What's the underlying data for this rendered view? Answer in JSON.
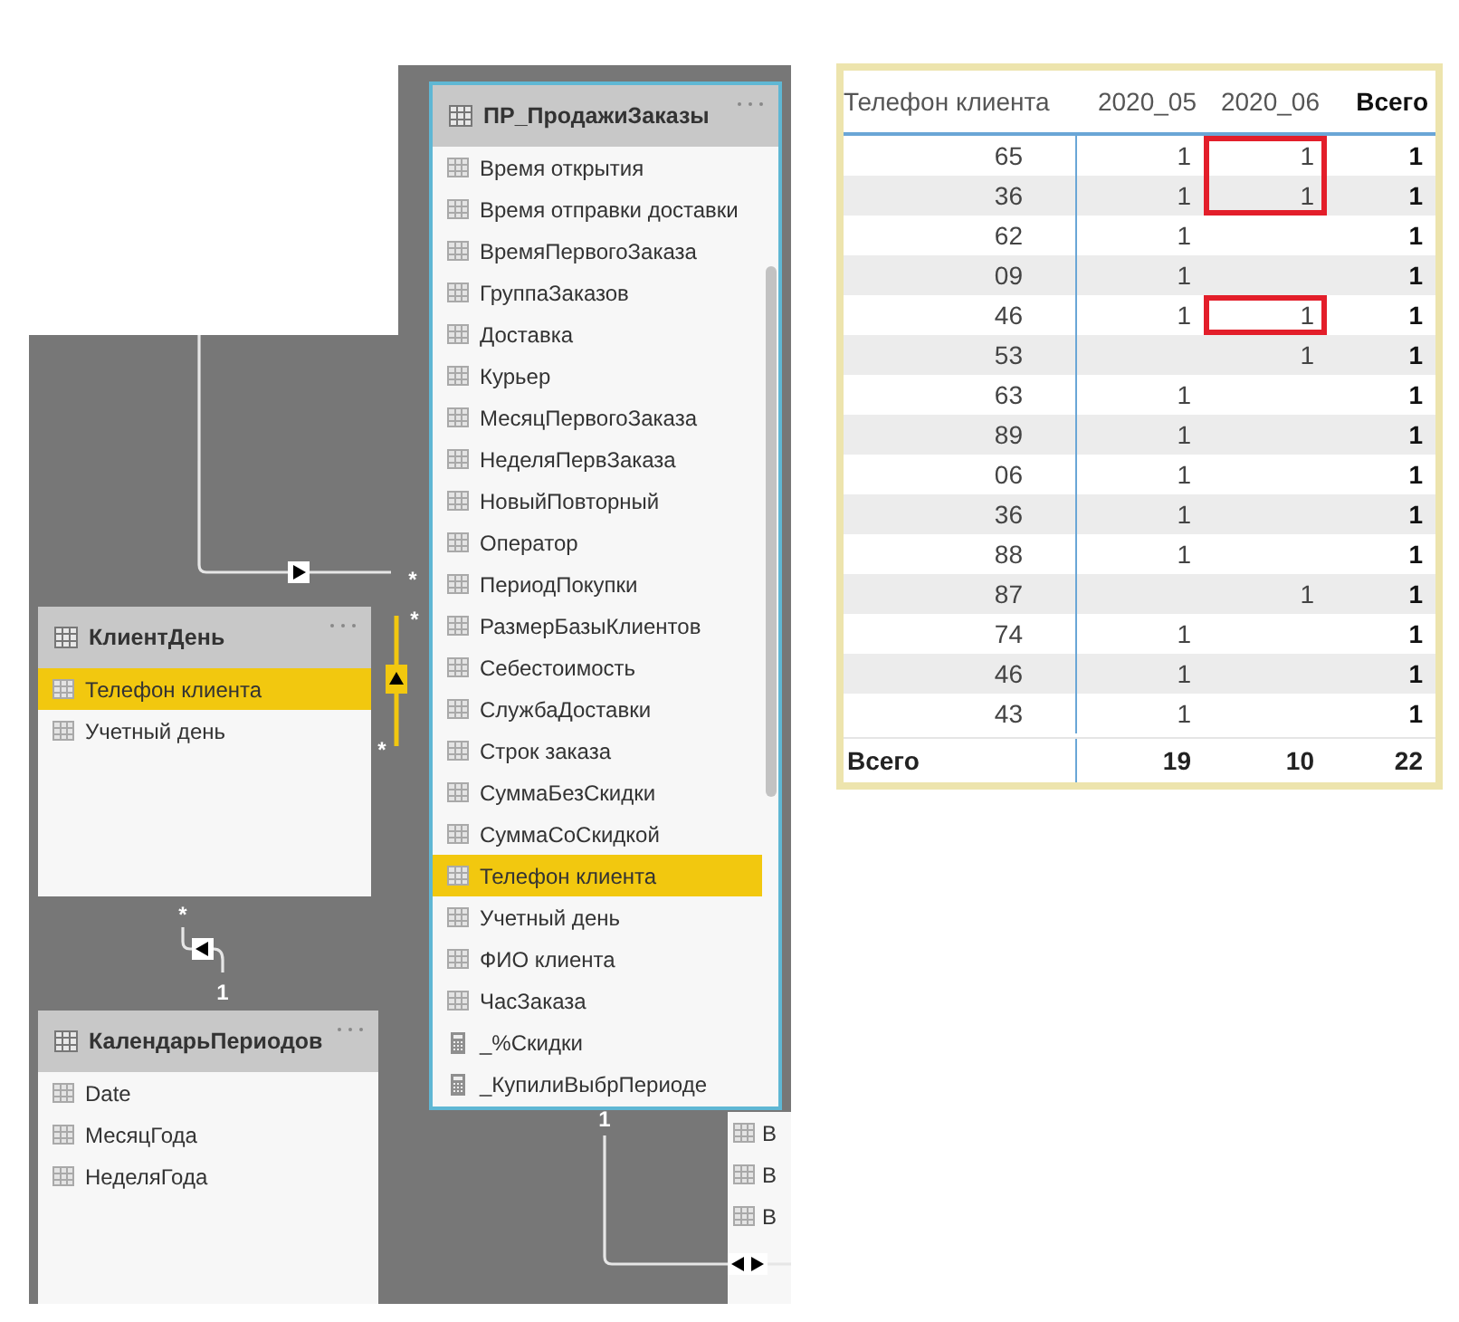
{
  "diagram": {
    "tables": [
      {
        "name": "ПР_ПродажиЗаказы",
        "selected": true,
        "fields": [
          {
            "name": "Время открытия",
            "kind": "column",
            "selected": false
          },
          {
            "name": "Время отправки доставки",
            "kind": "column",
            "selected": false
          },
          {
            "name": "ВремяПервогоЗаказа",
            "kind": "column",
            "selected": false
          },
          {
            "name": "ГруппаЗаказов",
            "kind": "column",
            "selected": false
          },
          {
            "name": "Доставка",
            "kind": "column",
            "selected": false
          },
          {
            "name": "Курьер",
            "kind": "column",
            "selected": false
          },
          {
            "name": "МесяцПервогоЗаказа",
            "kind": "column",
            "selected": false
          },
          {
            "name": "НеделяПервЗаказа",
            "kind": "column",
            "selected": false
          },
          {
            "name": "НовыйПовторный",
            "kind": "column",
            "selected": false
          },
          {
            "name": "Оператор",
            "kind": "column",
            "selected": false
          },
          {
            "name": "ПериодПокупки",
            "kind": "column",
            "selected": false
          },
          {
            "name": "РазмерБазыКлиентов",
            "kind": "column",
            "selected": false
          },
          {
            "name": "Себестоимость",
            "kind": "column",
            "selected": false
          },
          {
            "name": "СлужбаДоставки",
            "kind": "column",
            "selected": false
          },
          {
            "name": "Строк заказа",
            "kind": "column",
            "selected": false
          },
          {
            "name": "СуммаБезСкидки",
            "kind": "column",
            "selected": false
          },
          {
            "name": "СуммаСоСкидкой",
            "kind": "column",
            "selected": false
          },
          {
            "name": "Телефон клиента",
            "kind": "column",
            "selected": true
          },
          {
            "name": "Учетный день",
            "kind": "column",
            "selected": false
          },
          {
            "name": "ФИО клиента",
            "kind": "column",
            "selected": false
          },
          {
            "name": "ЧасЗаказа",
            "kind": "column",
            "selected": false
          },
          {
            "name": "_%Скидки",
            "kind": "measure",
            "selected": false
          },
          {
            "name": "_КупилиВыбрПериоде",
            "kind": "measure",
            "selected": false
          }
        ]
      },
      {
        "name": "КлиентДень",
        "selected": false,
        "fields": [
          {
            "name": "Телефон клиента",
            "kind": "column",
            "selected": true
          },
          {
            "name": "Учетный день",
            "kind": "column",
            "selected": false
          }
        ]
      },
      {
        "name": "КалендарьПериодов",
        "selected": false,
        "fields": [
          {
            "name": "Date",
            "kind": "column",
            "selected": false
          },
          {
            "name": "МесяцГода",
            "kind": "column",
            "selected": false
          },
          {
            "name": "НеделяГода",
            "kind": "column",
            "selected": false
          }
        ]
      },
      {
        "selected": false,
        "fields": [
          {
            "name": "В",
            "kind": "column",
            "selected": false
          },
          {
            "name": "В",
            "kind": "column",
            "selected": false
          },
          {
            "name": "В",
            "kind": "column",
            "selected": false
          }
        ]
      }
    ],
    "relationships": [
      {
        "kind": "right",
        "selected": false,
        "labels": [
          "*"
        ]
      },
      {
        "kind": "up",
        "selected": true,
        "labels": [
          "*",
          "*"
        ]
      },
      {
        "kind": "left",
        "selected": false,
        "labels": [
          "*",
          "1"
        ]
      },
      {
        "kind": "both",
        "selected": false,
        "labels": [
          "1"
        ]
      }
    ]
  },
  "matrix": {
    "columns": [
      "Телефон клиента",
      "2020_05",
      "2020_06",
      "Всего"
    ],
    "rows": [
      {
        "cells": [
          {
            "text": "65",
            "boxed": false
          },
          {
            "text": "1",
            "boxed": false
          },
          {
            "text": "1",
            "boxed": true
          },
          {
            "text": "1",
            "boxed": false
          }
        ]
      },
      {
        "cells": [
          {
            "text": "36",
            "boxed": false
          },
          {
            "text": "1",
            "boxed": false
          },
          {
            "text": "1",
            "boxed": true
          },
          {
            "text": "1",
            "boxed": false
          }
        ]
      },
      {
        "cells": [
          {
            "text": "62",
            "boxed": false
          },
          {
            "text": "1",
            "boxed": false
          },
          {
            "boxed": false
          },
          {
            "text": "1",
            "boxed": false
          }
        ]
      },
      {
        "cells": [
          {
            "text": "09",
            "boxed": false
          },
          {
            "text": "1",
            "boxed": false
          },
          {
            "boxed": false
          },
          {
            "text": "1",
            "boxed": false
          }
        ]
      },
      {
        "cells": [
          {
            "text": "46",
            "boxed": false
          },
          {
            "text": "1",
            "boxed": false
          },
          {
            "text": "1",
            "boxed": true
          },
          {
            "text": "1",
            "boxed": false
          }
        ]
      },
      {
        "cells": [
          {
            "text": "53",
            "boxed": false
          },
          {
            "boxed": false
          },
          {
            "text": "1",
            "boxed": false
          },
          {
            "text": "1",
            "boxed": false
          }
        ]
      },
      {
        "cells": [
          {
            "text": "63",
            "boxed": false
          },
          {
            "text": "1",
            "boxed": false
          },
          {
            "boxed": false
          },
          {
            "text": "1",
            "boxed": false
          }
        ]
      },
      {
        "cells": [
          {
            "text": "89",
            "boxed": false
          },
          {
            "text": "1",
            "boxed": false
          },
          {
            "boxed": false
          },
          {
            "text": "1",
            "boxed": false
          }
        ]
      },
      {
        "cells": [
          {
            "text": "06",
            "boxed": false
          },
          {
            "text": "1",
            "boxed": false
          },
          {
            "boxed": false
          },
          {
            "text": "1",
            "boxed": false
          }
        ]
      },
      {
        "cells": [
          {
            "text": "36",
            "boxed": false
          },
          {
            "text": "1",
            "boxed": false
          },
          {
            "boxed": false
          },
          {
            "text": "1",
            "boxed": false
          }
        ]
      },
      {
        "cells": [
          {
            "text": "88",
            "boxed": false
          },
          {
            "text": "1",
            "boxed": false
          },
          {
            "boxed": false
          },
          {
            "text": "1",
            "boxed": false
          }
        ]
      },
      {
        "cells": [
          {
            "text": "87",
            "boxed": false
          },
          {
            "boxed": false
          },
          {
            "text": "1",
            "boxed": false
          },
          {
            "text": "1",
            "boxed": false
          }
        ]
      },
      {
        "cells": [
          {
            "text": "74",
            "boxed": false
          },
          {
            "text": "1",
            "boxed": false
          },
          {
            "boxed": false
          },
          {
            "text": "1",
            "boxed": false
          }
        ]
      },
      {
        "cells": [
          {
            "text": "46",
            "boxed": false
          },
          {
            "text": "1",
            "boxed": false
          },
          {
            "boxed": false
          },
          {
            "text": "1",
            "boxed": false
          }
        ]
      },
      {
        "cells": [
          {
            "text": "43",
            "boxed": false
          },
          {
            "text": "1",
            "boxed": false
          },
          {
            "boxed": false
          },
          {
            "text": "1",
            "boxed": false
          }
        ]
      }
    ],
    "total_row": {
      "label": "Всего",
      "values": [
        "19",
        "10",
        "22"
      ]
    }
  }
}
